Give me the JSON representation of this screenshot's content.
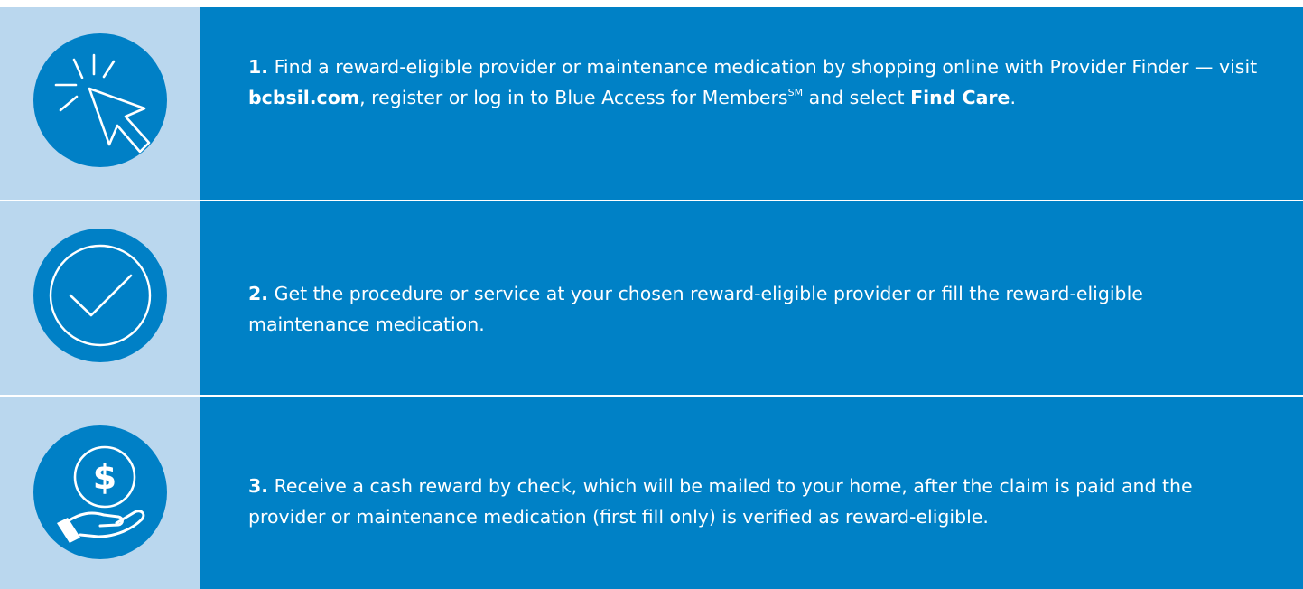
{
  "steps": [
    {
      "icon": "cursor-click-icon",
      "number": "1.",
      "text_a": "Find a reward-eligible provider or maintenance medication by shopping online with Provider Finder — visit ",
      "bold_a": "bcbsil.com",
      "text_b": ", register or log in to Blue Access for Members",
      "superscript": "SM",
      "text_c": " and select ",
      "bold_b": "Find Care",
      "text_d": "."
    },
    {
      "icon": "checkmark-icon",
      "number": "2.",
      "text": "Get the procedure or service at your chosen reward-eligible provider or fill the reward-eligible maintenance medication."
    },
    {
      "icon": "cash-in-hand-icon",
      "number": "3.",
      "text": "Receive a cash reward by check, which will be mailed to your home, after the claim is paid and the provider or maintenance medication (first fill only) is verified as reward-eligible.",
      "icon_symbol": "$"
    }
  ],
  "colors": {
    "icon_column": "#bad7ee",
    "panel": "#0081c6",
    "circle": "#0080c6",
    "text": "#ffffff"
  }
}
